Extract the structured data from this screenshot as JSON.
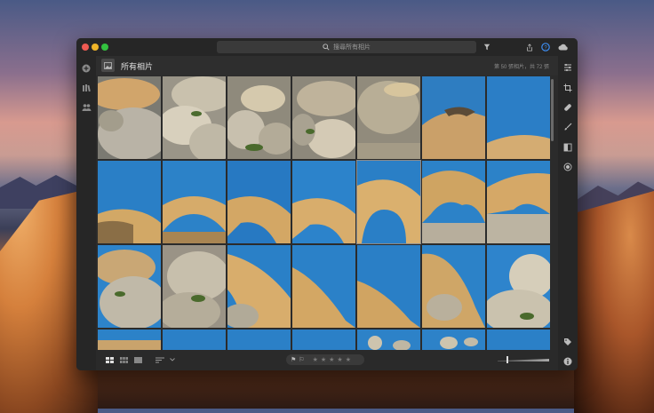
{
  "header": {
    "title": "所有相片",
    "count": "第 50 張相片，共 72 張"
  },
  "search": {
    "placeholder": "搜尋所有相片"
  },
  "rating": {
    "stars": [
      "★",
      "★",
      "★",
      "★",
      "★"
    ]
  },
  "colors": {
    "sky": "#2f7fc4",
    "rock": "#d2a866",
    "window_bg": "#2b2b2b"
  },
  "icons": {
    "titlebar": [
      "filter-icon",
      "share-icon",
      "help-icon",
      "cloud-icon"
    ],
    "left_sidebar": [
      "add-icon",
      "library-icon",
      "people-icon"
    ],
    "right_sidebar": [
      "edit-sliders-icon",
      "crop-icon",
      "healing-icon",
      "brush-icon",
      "gradient-icon",
      "radial-icon",
      "tag-icon",
      "info-icon"
    ],
    "bottom": [
      "grid-view-icon",
      "square-grid-icon",
      "detail-view-icon",
      "sort-icon",
      "chevron-down-icon",
      "flag-pick-icon",
      "flag-reject-icon"
    ]
  }
}
